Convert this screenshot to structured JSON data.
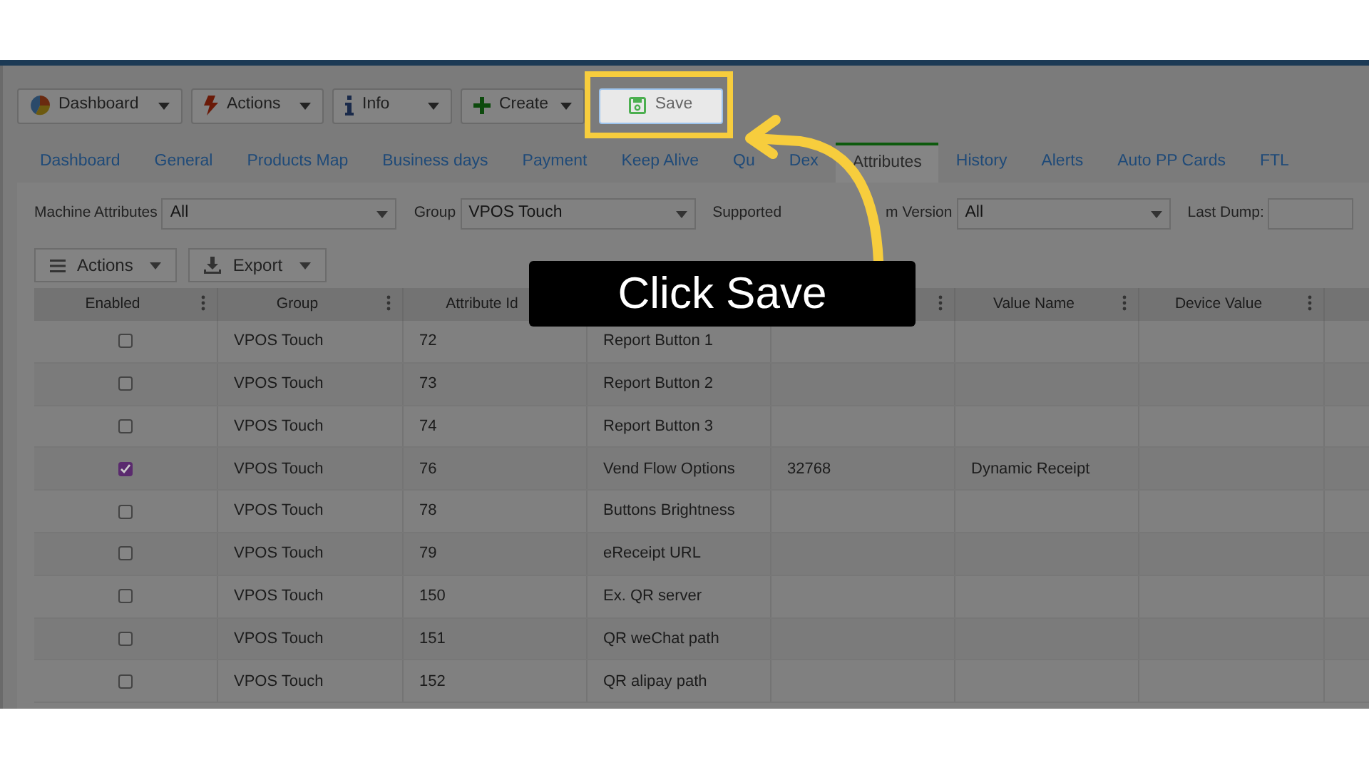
{
  "toolbar": {
    "buttons": [
      {
        "label": "Dashboard",
        "kind": "dropdown",
        "highlighted": false
      },
      {
        "label": "Actions",
        "kind": "dropdown",
        "highlighted": false
      },
      {
        "label": "Info",
        "kind": "dropdown",
        "highlighted": false
      },
      {
        "label": "Create",
        "kind": "dropdown",
        "highlighted": false
      },
      {
        "label": "Save",
        "kind": "button",
        "highlighted": true
      }
    ]
  },
  "tabs": [
    {
      "label": "Dashboard",
      "selected": false
    },
    {
      "label": "General",
      "selected": false
    },
    {
      "label": "Products Map",
      "selected": false
    },
    {
      "label": "Business days",
      "selected": false
    },
    {
      "label": "Payment",
      "selected": false
    },
    {
      "label": "Keep Alive",
      "selected": false
    },
    {
      "label": "Qu",
      "selected": false
    },
    {
      "label": "Dex",
      "selected": false
    },
    {
      "label": "Attributes",
      "selected": true
    },
    {
      "label": "History",
      "selected": false
    },
    {
      "label": "Alerts",
      "selected": false
    },
    {
      "label": "Auto PP Cards",
      "selected": false
    },
    {
      "label": "FTL",
      "selected": false
    }
  ],
  "filters": [
    {
      "label": "Machine Attributes",
      "value": "All",
      "kind": "select"
    },
    {
      "label": "Group",
      "value": "VPOS Touch",
      "kind": "select"
    },
    {
      "label": "Supported",
      "label_2": "m Version",
      "value": "All",
      "kind": "select"
    },
    {
      "label": "Last Dump:",
      "kind": "text"
    }
  ],
  "grid_toolbar": [
    {
      "label": "Actions"
    },
    {
      "label": "Export"
    }
  ],
  "table": {
    "columns": [
      "Enabled",
      "Group",
      "Attribute Id",
      "",
      "",
      "Value Name",
      "Device Value"
    ],
    "rows": [
      {
        "enabled": false,
        "group": "VPOS Touch",
        "attribute_id": "72",
        "column_4": "Report Button 1"
      },
      {
        "enabled": false,
        "group": "VPOS Touch",
        "attribute_id": "73",
        "column_4": "Report Button 2"
      },
      {
        "enabled": false,
        "group": "VPOS Touch",
        "attribute_id": "74",
        "column_4": "Report Button 3"
      },
      {
        "enabled": true,
        "group": "VPOS Touch",
        "attribute_id": "76",
        "column_4": "Vend Flow Options",
        "column_5": "32768",
        "value_name": "Dynamic Receipt"
      },
      {
        "enabled": false,
        "group": "VPOS Touch",
        "attribute_id": "78",
        "column_4": "Buttons Brightness"
      },
      {
        "enabled": false,
        "group": "VPOS Touch",
        "attribute_id": "79",
        "column_4": "eReceipt URL"
      },
      {
        "enabled": false,
        "group": "VPOS Touch",
        "attribute_id": "150",
        "column_4": "Ex. QR server"
      },
      {
        "enabled": false,
        "group": "VPOS Touch",
        "attribute_id": "151",
        "column_4": "QR weChat path"
      },
      {
        "enabled": false,
        "group": "VPOS Touch",
        "attribute_id": "152",
        "column_4": "QR alipay path"
      }
    ]
  },
  "tutorial": {
    "callout": "Click Save"
  }
}
